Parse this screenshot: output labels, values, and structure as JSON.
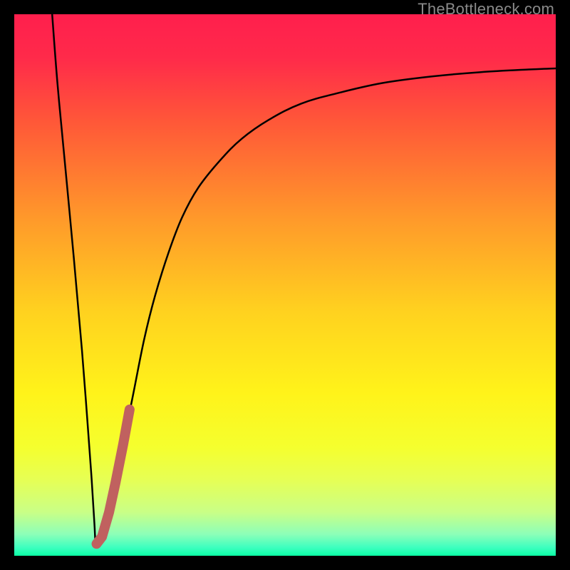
{
  "watermark": "TheBottleneck.com",
  "chart_data": {
    "type": "line",
    "title": "",
    "xlabel": "",
    "ylabel": "",
    "xlim": [
      0,
      100
    ],
    "ylim": [
      0,
      100
    ],
    "gradient_stops": [
      {
        "offset": 0.0,
        "color": "#ff1f4d"
      },
      {
        "offset": 0.08,
        "color": "#ff2a4a"
      },
      {
        "offset": 0.2,
        "color": "#ff5838"
      },
      {
        "offset": 0.38,
        "color": "#ff9a2a"
      },
      {
        "offset": 0.55,
        "color": "#ffd21f"
      },
      {
        "offset": 0.7,
        "color": "#fff31a"
      },
      {
        "offset": 0.8,
        "color": "#f5ff2e"
      },
      {
        "offset": 0.86,
        "color": "#e6ff55"
      },
      {
        "offset": 0.92,
        "color": "#c9ff87"
      },
      {
        "offset": 0.96,
        "color": "#8dffb8"
      },
      {
        "offset": 0.985,
        "color": "#3cffbf"
      },
      {
        "offset": 1.0,
        "color": "#0bffa5"
      }
    ],
    "series": [
      {
        "name": "bottleneck-curve",
        "color": "#000000",
        "width": 2.5,
        "x": [
          7.0,
          8.0,
          9.5,
          11.0,
          12.5,
          13.5,
          14.3,
          14.8,
          15.0,
          15.3,
          16.0,
          17.0,
          18.5,
          20.0,
          22.0,
          24.0,
          26.0,
          28.5,
          31.0,
          34.0,
          38.0,
          42.0,
          47.0,
          53.0,
          60.0,
          68.0,
          77.0,
          86.0,
          95.0,
          100.0
        ],
        "y": [
          100.0,
          87.0,
          71.0,
          55.0,
          38.0,
          25.0,
          14.0,
          6.0,
          2.5,
          2.0,
          3.0,
          6.0,
          12.0,
          20.0,
          30.0,
          40.0,
          48.0,
          56.0,
          62.5,
          68.0,
          73.0,
          77.0,
          80.5,
          83.5,
          85.5,
          87.3,
          88.5,
          89.3,
          89.8,
          90.0
        ]
      },
      {
        "name": "highlight-segment",
        "color": "#c0615f",
        "width": 14,
        "linecap": "round",
        "x": [
          15.2,
          16.2,
          17.5,
          18.7,
          20.1,
          21.3
        ],
        "y": [
          2.2,
          3.5,
          8.0,
          13.5,
          20.5,
          27.0
        ]
      }
    ]
  }
}
